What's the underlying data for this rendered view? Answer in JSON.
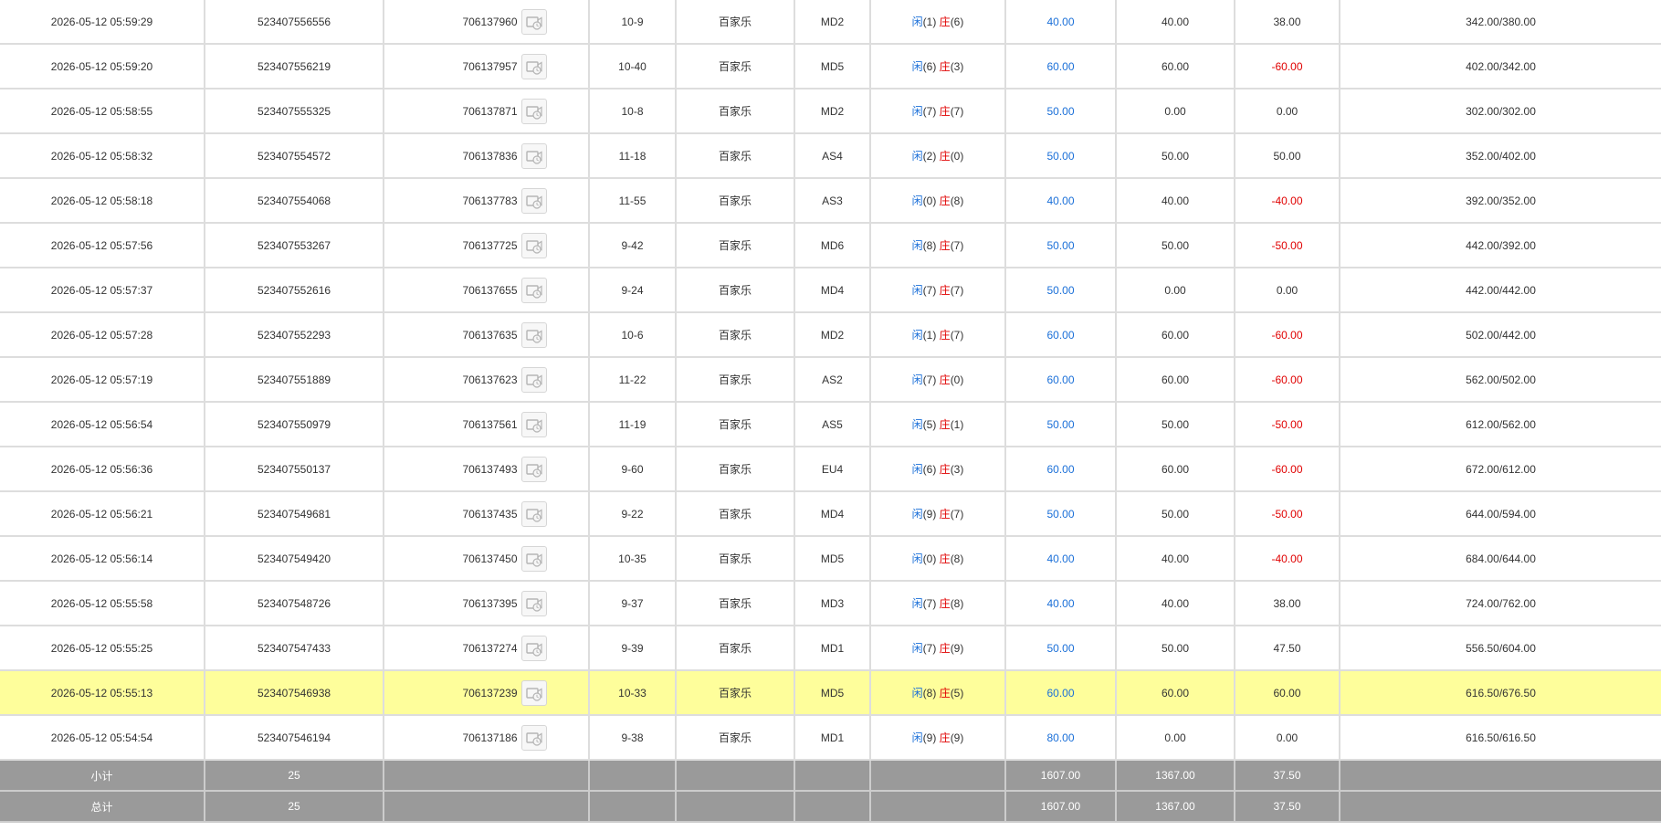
{
  "icons": {
    "replay": "video-replay-icon"
  },
  "colors": {
    "player": "#1a6fd8",
    "banker": "#e00000",
    "negative": "#e00000",
    "bet": "#1a6fd8",
    "highlight": "#fefe9b",
    "summary_bg": "#9a9a9a"
  },
  "rows": [
    {
      "time": "2026-05-12 05:59:29",
      "order_id": "523407556556",
      "txn_id": "706137960",
      "round": "10-9",
      "game": "百家乐",
      "table": "MD2",
      "player_label": "闲",
      "player_points": "(1)",
      "banker_label": "庄",
      "banker_points": "(6)",
      "bet": "40.00",
      "valid_bet": "40.00",
      "win_loss": "38.00",
      "win_neg": false,
      "balance": "342.00/380.00",
      "highlighted": false
    },
    {
      "time": "2026-05-12 05:59:20",
      "order_id": "523407556219",
      "txn_id": "706137957",
      "round": "10-40",
      "game": "百家乐",
      "table": "MD5",
      "player_label": "闲",
      "player_points": "(6)",
      "banker_label": "庄",
      "banker_points": "(3)",
      "bet": "60.00",
      "valid_bet": "60.00",
      "win_loss": "-60.00",
      "win_neg": true,
      "balance": "402.00/342.00",
      "highlighted": false
    },
    {
      "time": "2026-05-12 05:58:55",
      "order_id": "523407555325",
      "txn_id": "706137871",
      "round": "10-8",
      "game": "百家乐",
      "table": "MD2",
      "player_label": "闲",
      "player_points": "(7)",
      "banker_label": "庄",
      "banker_points": "(7)",
      "bet": "50.00",
      "valid_bet": "0.00",
      "win_loss": "0.00",
      "win_neg": false,
      "balance": "302.00/302.00",
      "highlighted": false
    },
    {
      "time": "2026-05-12 05:58:32",
      "order_id": "523407554572",
      "txn_id": "706137836",
      "round": "11-18",
      "game": "百家乐",
      "table": "AS4",
      "player_label": "闲",
      "player_points": "(2)",
      "banker_label": "庄",
      "banker_points": "(0)",
      "bet": "50.00",
      "valid_bet": "50.00",
      "win_loss": "50.00",
      "win_neg": false,
      "balance": "352.00/402.00",
      "highlighted": false
    },
    {
      "time": "2026-05-12 05:58:18",
      "order_id": "523407554068",
      "txn_id": "706137783",
      "round": "11-55",
      "game": "百家乐",
      "table": "AS3",
      "player_label": "闲",
      "player_points": "(0)",
      "banker_label": "庄",
      "banker_points": "(8)",
      "bet": "40.00",
      "valid_bet": "40.00",
      "win_loss": "-40.00",
      "win_neg": true,
      "balance": "392.00/352.00",
      "highlighted": false
    },
    {
      "time": "2026-05-12 05:57:56",
      "order_id": "523407553267",
      "txn_id": "706137725",
      "round": "9-42",
      "game": "百家乐",
      "table": "MD6",
      "player_label": "闲",
      "player_points": "(8)",
      "banker_label": "庄",
      "banker_points": "(7)",
      "bet": "50.00",
      "valid_bet": "50.00",
      "win_loss": "-50.00",
      "win_neg": true,
      "balance": "442.00/392.00",
      "highlighted": false
    },
    {
      "time": "2026-05-12 05:57:37",
      "order_id": "523407552616",
      "txn_id": "706137655",
      "round": "9-24",
      "game": "百家乐",
      "table": "MD4",
      "player_label": "闲",
      "player_points": "(7)",
      "banker_label": "庄",
      "banker_points": "(7)",
      "bet": "50.00",
      "valid_bet": "0.00",
      "win_loss": "0.00",
      "win_neg": false,
      "balance": "442.00/442.00",
      "highlighted": false
    },
    {
      "time": "2026-05-12 05:57:28",
      "order_id": "523407552293",
      "txn_id": "706137635",
      "round": "10-6",
      "game": "百家乐",
      "table": "MD2",
      "player_label": "闲",
      "player_points": "(1)",
      "banker_label": "庄",
      "banker_points": "(7)",
      "bet": "60.00",
      "valid_bet": "60.00",
      "win_loss": "-60.00",
      "win_neg": true,
      "balance": "502.00/442.00",
      "highlighted": false
    },
    {
      "time": "2026-05-12 05:57:19",
      "order_id": "523407551889",
      "txn_id": "706137623",
      "round": "11-22",
      "game": "百家乐",
      "table": "AS2",
      "player_label": "闲",
      "player_points": "(7)",
      "banker_label": "庄",
      "banker_points": "(0)",
      "bet": "60.00",
      "valid_bet": "60.00",
      "win_loss": "-60.00",
      "win_neg": true,
      "balance": "562.00/502.00",
      "highlighted": false
    },
    {
      "time": "2026-05-12 05:56:54",
      "order_id": "523407550979",
      "txn_id": "706137561",
      "round": "11-19",
      "game": "百家乐",
      "table": "AS5",
      "player_label": "闲",
      "player_points": "(5)",
      "banker_label": "庄",
      "banker_points": "(1)",
      "bet": "50.00",
      "valid_bet": "50.00",
      "win_loss": "-50.00",
      "win_neg": true,
      "balance": "612.00/562.00",
      "highlighted": false
    },
    {
      "time": "2026-05-12 05:56:36",
      "order_id": "523407550137",
      "txn_id": "706137493",
      "round": "9-60",
      "game": "百家乐",
      "table": "EU4",
      "player_label": "闲",
      "player_points": "(6)",
      "banker_label": "庄",
      "banker_points": "(3)",
      "bet": "60.00",
      "valid_bet": "60.00",
      "win_loss": "-60.00",
      "win_neg": true,
      "balance": "672.00/612.00",
      "highlighted": false
    },
    {
      "time": "2026-05-12 05:56:21",
      "order_id": "523407549681",
      "txn_id": "706137435",
      "round": "9-22",
      "game": "百家乐",
      "table": "MD4",
      "player_label": "闲",
      "player_points": "(9)",
      "banker_label": "庄",
      "banker_points": "(7)",
      "bet": "50.00",
      "valid_bet": "50.00",
      "win_loss": "-50.00",
      "win_neg": true,
      "balance": "644.00/594.00",
      "highlighted": false
    },
    {
      "time": "2026-05-12 05:56:14",
      "order_id": "523407549420",
      "txn_id": "706137450",
      "round": "10-35",
      "game": "百家乐",
      "table": "MD5",
      "player_label": "闲",
      "player_points": "(0)",
      "banker_label": "庄",
      "banker_points": "(8)",
      "bet": "40.00",
      "valid_bet": "40.00",
      "win_loss": "-40.00",
      "win_neg": true,
      "balance": "684.00/644.00",
      "highlighted": false
    },
    {
      "time": "2026-05-12 05:55:58",
      "order_id": "523407548726",
      "txn_id": "706137395",
      "round": "9-37",
      "game": "百家乐",
      "table": "MD3",
      "player_label": "闲",
      "player_points": "(7)",
      "banker_label": "庄",
      "banker_points": "(8)",
      "bet": "40.00",
      "valid_bet": "40.00",
      "win_loss": "38.00",
      "win_neg": false,
      "balance": "724.00/762.00",
      "highlighted": false
    },
    {
      "time": "2026-05-12 05:55:25",
      "order_id": "523407547433",
      "txn_id": "706137274",
      "round": "9-39",
      "game": "百家乐",
      "table": "MD1",
      "player_label": "闲",
      "player_points": "(7)",
      "banker_label": "庄",
      "banker_points": "(9)",
      "bet": "50.00",
      "valid_bet": "50.00",
      "win_loss": "47.50",
      "win_neg": false,
      "balance": "556.50/604.00",
      "highlighted": false
    },
    {
      "time": "2026-05-12 05:55:13",
      "order_id": "523407546938",
      "txn_id": "706137239",
      "round": "10-33",
      "game": "百家乐",
      "table": "MD5",
      "player_label": "闲",
      "player_points": "(8)",
      "banker_label": "庄",
      "banker_points": "(5)",
      "bet": "60.00",
      "valid_bet": "60.00",
      "win_loss": "60.00",
      "win_neg": false,
      "balance": "616.50/676.50",
      "highlighted": true
    },
    {
      "time": "2026-05-12 05:54:54",
      "order_id": "523407546194",
      "txn_id": "706137186",
      "round": "9-38",
      "game": "百家乐",
      "table": "MD1",
      "player_label": "闲",
      "player_points": "(9)",
      "banker_label": "庄",
      "banker_points": "(9)",
      "bet": "80.00",
      "valid_bet": "0.00",
      "win_loss": "0.00",
      "win_neg": false,
      "balance": "616.50/616.50",
      "highlighted": false
    }
  ],
  "subtotal": {
    "label": "小计",
    "count": "25",
    "bet": "1607.00",
    "valid_bet": "1367.00",
    "win_loss": "37.50"
  },
  "total": {
    "label": "总计",
    "count": "25",
    "bet": "1607.00",
    "valid_bet": "1367.00",
    "win_loss": "37.50"
  }
}
